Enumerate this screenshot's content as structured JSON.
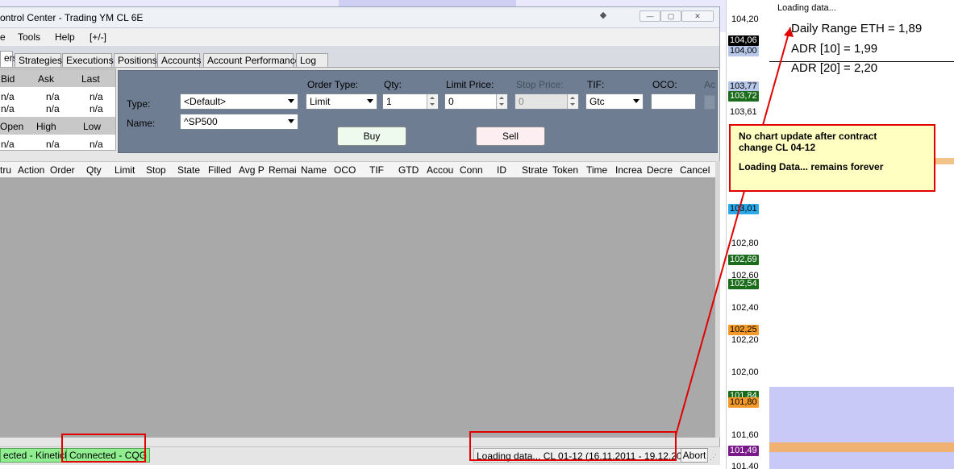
{
  "window": {
    "title": "ontrol Center - Trading YM CL 6E",
    "title_buttons": [
      "◆",
      "—",
      "▢",
      "✕"
    ]
  },
  "menu": {
    "items": [
      "e",
      "Tools",
      "Help",
      "[+/-]"
    ]
  },
  "tabs": [
    "ers",
    "Strategies",
    "Executions",
    "Positions",
    "Accounts",
    "Account Performance",
    "Log"
  ],
  "quotes": {
    "header1": [
      "Bid",
      "Ask",
      "Last"
    ],
    "row1": [
      "n/a",
      "n/a",
      "n/a"
    ],
    "row2": [
      "n/a",
      "n/a",
      "n/a"
    ],
    "header2": [
      "Open",
      "High",
      "Low"
    ],
    "row3": [
      "n/a",
      "n/a",
      "n/a"
    ]
  },
  "order_entry": {
    "type_label": "Type:",
    "type_value": "<Default>",
    "name_label": "Name:",
    "name_value": "^SP500",
    "order_type_label": "Order Type:",
    "order_type_value": "Limit",
    "qty_label": "Qty:",
    "qty_value": "1",
    "limit_price_label": "Limit Price:",
    "limit_price_value": "0",
    "stop_price_label": "Stop Price:",
    "stop_price_value": "0",
    "tif_label": "TIF:",
    "tif_value": "Gtc",
    "oco_label": "OCO:",
    "oco_value": "",
    "extra_label": "Ac",
    "buy_label": "Buy",
    "sell_label": "Sell"
  },
  "grid": {
    "columns": [
      "tru",
      "Action",
      "Order",
      "Qty",
      "Limit",
      "Stop",
      "State",
      "Filled",
      "Avg P",
      "Remai",
      "Name",
      "OCO",
      "TIF",
      "GTD",
      "Accou",
      "Conn",
      "ID",
      "Strate",
      "Token",
      "Time",
      "Increa",
      "Decre",
      "Cancel"
    ]
  },
  "status": {
    "conn1": "ected - Kinetick",
    "conn2": "Connected - CQG",
    "loading": "Loading data... CL 01-12  (16.11.2011 - 19.12.2011)",
    "abort": "Abort"
  },
  "price_axis": {
    "ticks": [
      "104,20",
      "102,80",
      "102,60",
      "102,40",
      "102,20",
      "102,00",
      "101,60",
      "101,40"
    ],
    "labels": [
      {
        "text": "104,06",
        "bg": "#000000",
        "fg": "#ffffff"
      },
      {
        "text": "104,00",
        "bg": "#b7c8ea",
        "fg": "#000000"
      },
      {
        "text": "103,77",
        "bg": "#b7c8ea",
        "fg": "#000000"
      },
      {
        "text": "103,72",
        "bg": "#1a6b1a",
        "fg": "#ffffff"
      },
      {
        "text": "103,61",
        "bg": "#ffffff",
        "fg": "#000000"
      },
      {
        "text": "103,01",
        "bg": "#2aa8e8",
        "fg": "#000000"
      },
      {
        "text": "102,69",
        "bg": "#1a6b1a",
        "fg": "#ffffff"
      },
      {
        "text": "102,54",
        "bg": "#1a6b1a",
        "fg": "#ffffff"
      },
      {
        "text": "102,25",
        "bg": "#f39a2a",
        "fg": "#000000"
      },
      {
        "text": "101,84",
        "bg": "#1a6b1a",
        "fg": "#ffffff"
      },
      {
        "text": "101,80",
        "bg": "#f39a2a",
        "fg": "#000000"
      },
      {
        "text": "101,49",
        "bg": "#7a1a8a",
        "fg": "#ffffff"
      }
    ]
  },
  "chart": {
    "loading": "Loading data...",
    "stats": [
      "Daily Range ETH = 1,89",
      "ADR [10] = 1,99",
      "ADR [20] = 2,20"
    ]
  },
  "callout": {
    "line1": "No chart update after contract",
    "line2": "change CL 04-12",
    "line3": "Loading Data... remains forever"
  },
  "colors": {
    "highlight_red": "#e00000",
    "connected_green": "#90ee90",
    "callout_yellow": "#ffffc2",
    "entry_panel": "#6e7d92",
    "buy_bg": "#eefaee",
    "sell_bg": "#fdeef2"
  }
}
